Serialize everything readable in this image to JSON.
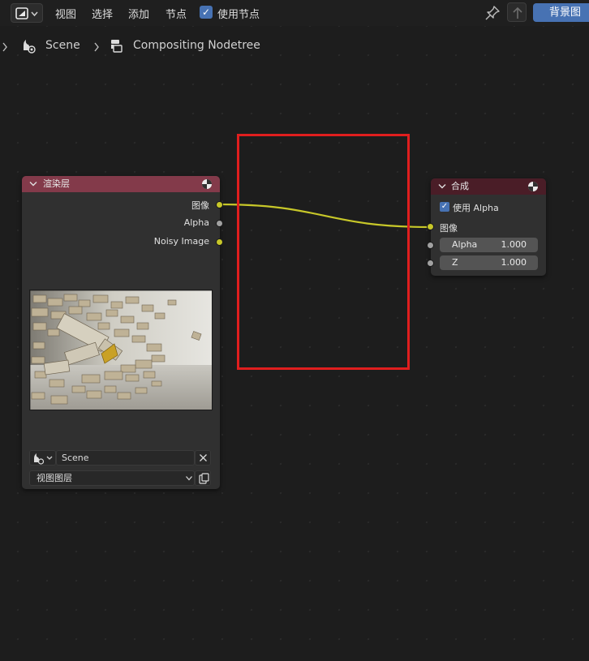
{
  "header": {
    "menu": [
      "视图",
      "选择",
      "添加",
      "节点"
    ],
    "use_nodes_label": "使用节点",
    "use_nodes_checked": true,
    "backdrop_button": "背景图"
  },
  "breadcrumb": {
    "scene": "Scene",
    "nodetree": "Compositing Nodetree"
  },
  "render_layers_node": {
    "title": "渲染层",
    "header_color": "#833a4a",
    "outputs": [
      {
        "label": "图像",
        "color": "#c7c729"
      },
      {
        "label": "Alpha",
        "color": "#a1a1a1"
      },
      {
        "label": "Noisy Image",
        "color": "#c7c729"
      }
    ],
    "scene_name": "Scene",
    "view_layer": "视图图层"
  },
  "composite_node": {
    "title": "合成",
    "header_color": "#4a1d27",
    "use_alpha_label": "使用 Alpha",
    "use_alpha_checked": true,
    "input_label": "图像",
    "fields": [
      {
        "label": "Alpha",
        "value": "1.000"
      },
      {
        "label": "Z",
        "value": "1.000"
      }
    ]
  },
  "colors": {
    "accent": "#4772b3",
    "link": "#c7c729",
    "highlight_box": "#e01e1e"
  }
}
